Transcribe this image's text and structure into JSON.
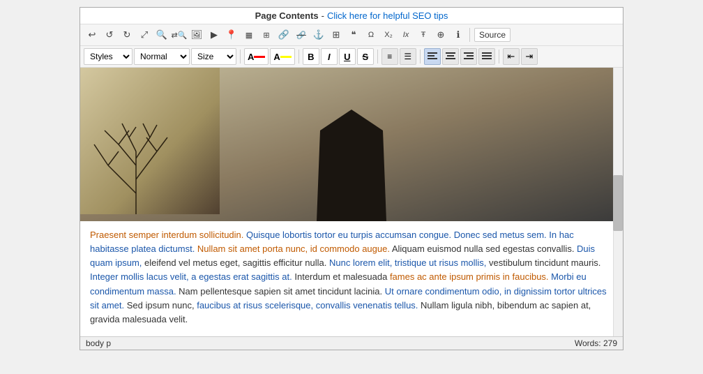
{
  "topbar": {
    "title": "Page Contents",
    "separator": " - ",
    "link_text": "Click here for helpful SEO tips"
  },
  "toolbar1": {
    "source_label": "Source",
    "icons": [
      "undo",
      "redo",
      "forward",
      "fullscreen",
      "find",
      "find-replace",
      "image",
      "video",
      "location",
      "special",
      "table-cell",
      "link",
      "unlink",
      "anchor",
      "table",
      "blockquote",
      "special-chars",
      "subscript",
      "italic-remove",
      "clear",
      "omega",
      "info",
      "source"
    ]
  },
  "toolbar2": {
    "styles_label": "Styles",
    "format_label": "Normal",
    "size_label": "Size",
    "font_color_label": "A",
    "font_bg_label": "A",
    "bold_label": "B",
    "italic_label": "I",
    "underline_label": "U",
    "strikethrough_label": "S",
    "ordered_list": "ol",
    "unordered_list": "ul",
    "align_left": "align-left",
    "align_center": "align-center",
    "align_right": "align-right",
    "align_justify": "align-justify",
    "indent_decrease": "indent-out",
    "indent_increase": "indent-in"
  },
  "content": {
    "paragraph": "Praesent semper interdum sollicitudin. Quisque lobortis tortor eu turpis accumsan congue. Donec sed metus sem. In hac habitasse platea dictumst. Nullam sit amet porta nunc, id commodo augue. Aliquam euismod nulla sed egestas convallis. Duis quam ipsum, eleifend vel metus eget, sagittis efficitur nulla. Nunc lorem elit, tristique ut risus mollis, vestibulum tincidunt mauris. Integer mollis lacus velit, a egestas erat sagittis at. Interdum et malesuada fames ac ante ipsum primis in faucibus. Morbi eu condimentum massa. Nam pellentesque sapien sit amet tincidunt lacinia. Ut ornare condimentum odio, in dignissim tortor ultrices sit amet. Sed ipsum nunc, faucibus at risus scelerisque, convallis venenatis tellus. Nullam ligula nibh, bibendum ac sapien at, gravida malesuada velit."
  },
  "statusbar": {
    "tags": "body  p",
    "words_label": "Words: 279"
  },
  "colors": {
    "font_color_bar": "#ff0000",
    "font_bg_bar": "#ffff00",
    "accent_blue": "#1a56aa",
    "link_blue": "#0066cc"
  }
}
